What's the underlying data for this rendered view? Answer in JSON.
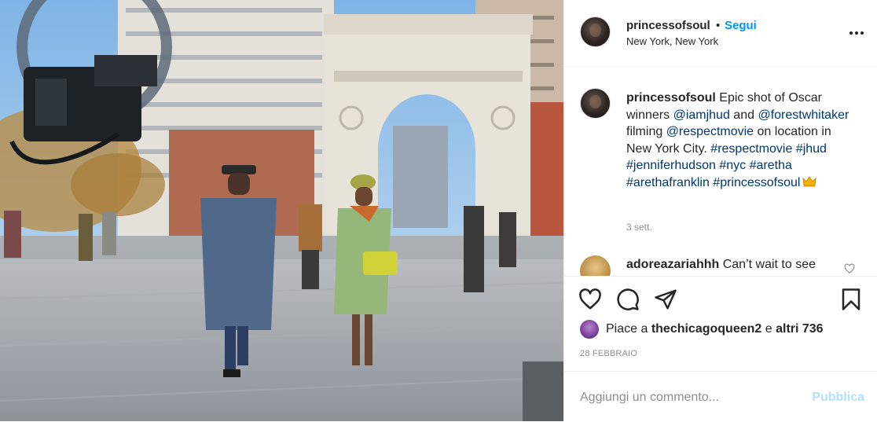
{
  "header": {
    "username": "princessofsoul",
    "separator": "•",
    "follow_label": "Segui",
    "location": "New York, New York",
    "more_icon": "more-options-icon"
  },
  "caption": {
    "username": "princessofsoul",
    "parts": [
      {
        "text": "Epic shot of Oscar winners ",
        "link": false
      },
      {
        "text": "@iamjhud",
        "link": true
      },
      {
        "text": " and ",
        "link": false
      },
      {
        "text": "@forestwhitaker",
        "link": true
      },
      {
        "text": " filming ",
        "link": false
      },
      {
        "text": "@respectmovie",
        "link": true
      },
      {
        "text": " on location in New York City. ",
        "link": false
      },
      {
        "text": "#respectmovie",
        "link": true
      },
      {
        "text": " ",
        "link": false
      },
      {
        "text": "#jhud",
        "link": true
      },
      {
        "text": " ",
        "link": false
      },
      {
        "text": "#jenniferhudson",
        "link": true
      },
      {
        "text": " ",
        "link": false
      },
      {
        "text": "#nyc",
        "link": true
      },
      {
        "text": " ",
        "link": false
      },
      {
        "text": "#aretha",
        "link": true
      },
      {
        "text": " ",
        "link": false
      },
      {
        "text": "#arethafranklin",
        "link": true
      },
      {
        "text": " ",
        "link": false
      },
      {
        "text": "#princessofsoul",
        "link": true
      }
    ],
    "emoji": "crown-emoji",
    "time": "3 sett."
  },
  "comment": {
    "username": "adoreazariahhh",
    "text": "Can’t wait to see"
  },
  "actions": {
    "like_icon": "heart-icon",
    "comment_icon": "comment-icon",
    "share_icon": "paper-plane-icon",
    "save_icon": "bookmark-icon"
  },
  "likes": {
    "prefix": "Piace a ",
    "user": "thechicagoqueen2",
    "middle": " e ",
    "others": "altri 736"
  },
  "date": "28 FEBBRAIO",
  "add_comment": {
    "placeholder": "Aggiungi un commento...",
    "publish_label": "Pubblica"
  },
  "colors": {
    "accent": "#0095f6",
    "link": "#00376b",
    "muted": "#8e8e8e",
    "publish_disabled": "#b2dffc"
  }
}
